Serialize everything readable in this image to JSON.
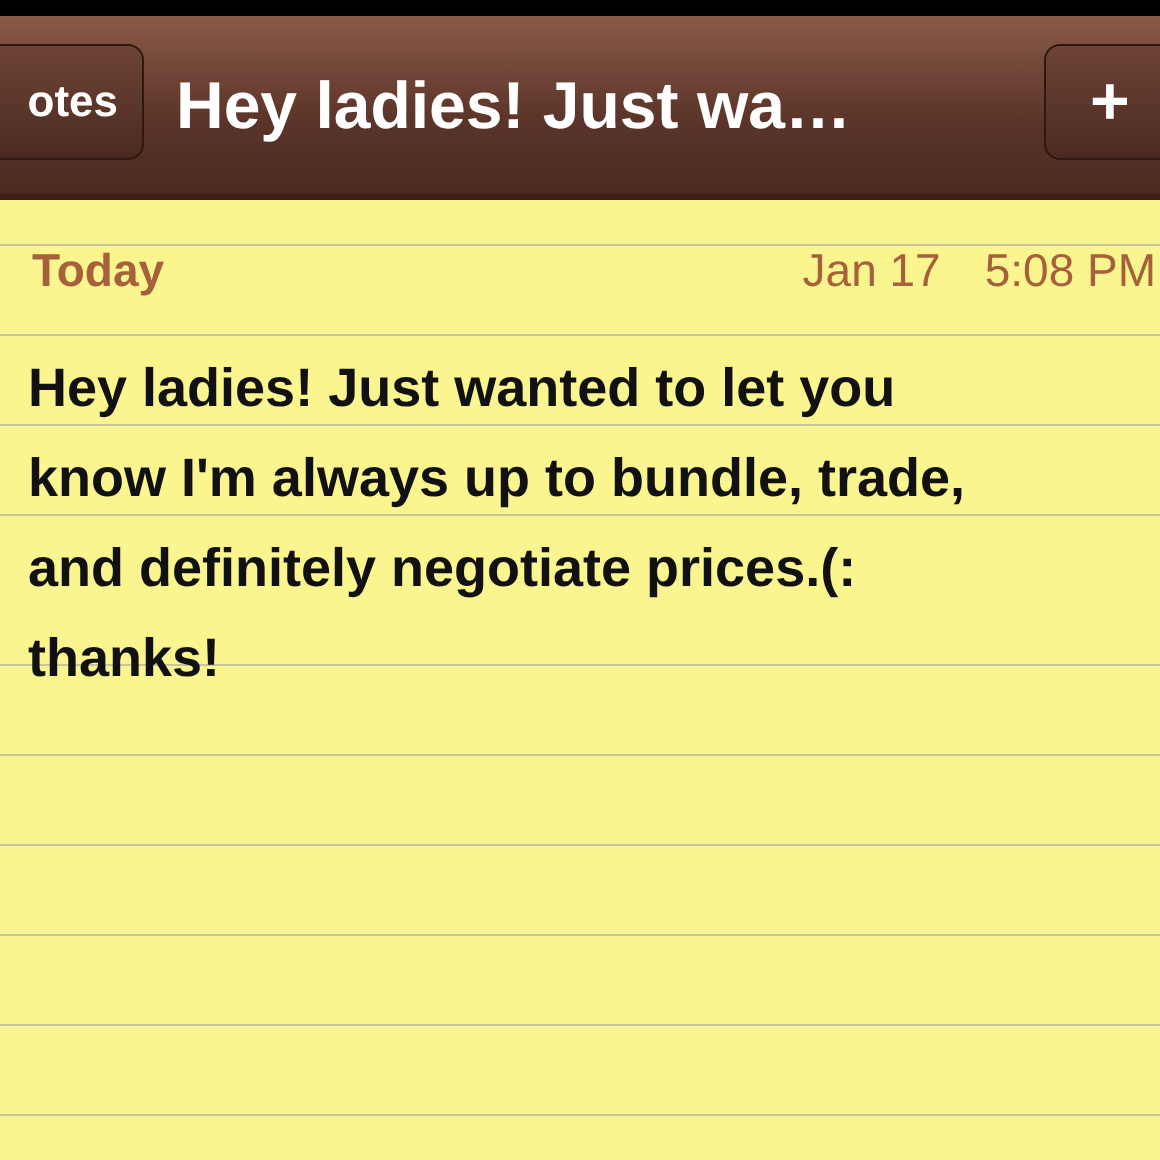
{
  "nav_bar": {
    "back_button": "otes",
    "title": "Hey ladies! Just wa…",
    "add_button": "+"
  },
  "note": {
    "day": "Today",
    "date": "Jan 17",
    "time": "5:08 PM",
    "body": "Hey ladies! Just wanted to let you\nknow I'm always up to bundle, trade,\nand definitely negotiate prices.(:\nthanks!"
  }
}
